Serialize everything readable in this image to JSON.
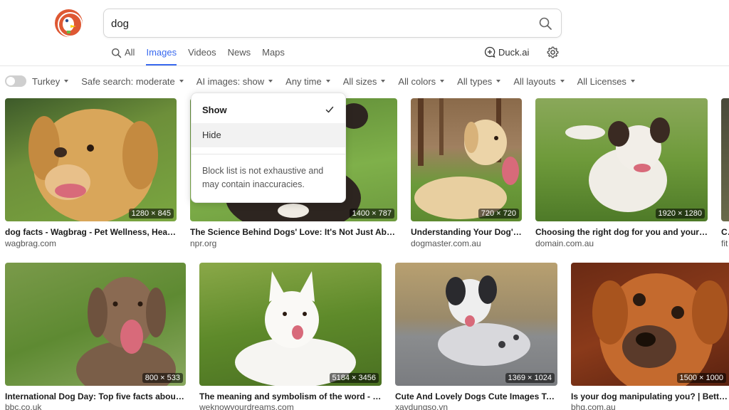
{
  "search": {
    "query": "dog"
  },
  "tabs": [
    {
      "label": "All",
      "icon": "search-icon"
    },
    {
      "label": "Images",
      "active": true
    },
    {
      "label": "Videos"
    },
    {
      "label": "News"
    },
    {
      "label": "Maps"
    }
  ],
  "header": {
    "duck_ai_label": "Duck.ai"
  },
  "filters": {
    "region": "Turkey",
    "safe_search": "Safe search: moderate",
    "ai_images": "AI images: show",
    "time": "Any time",
    "sizes": "All sizes",
    "colors": "All colors",
    "types": "All types",
    "layouts": "All layouts",
    "licenses": "All Licenses"
  },
  "dropdown": {
    "options": [
      {
        "label": "Show",
        "selected": true
      },
      {
        "label": "Hide",
        "selected": false
      }
    ],
    "note": "Block list is not exhaustive and may contain inaccuracies."
  },
  "results_row1": [
    {
      "title": "dog facts - Wagbrag - Pet Wellness, Healthcare",
      "site": "wagbrag.com",
      "dims": "1280 × 845"
    },
    {
      "title": "The Science Behind Dogs' Love: It's Not Just About Food",
      "site": "npr.org",
      "dims": "1400 × 787"
    },
    {
      "title": "Understanding Your Dog's Behaviour",
      "site": "dogmaster.com.au",
      "dims": "720 × 720"
    },
    {
      "title": "Choosing the right dog for you and your family",
      "site": "domain.com.au",
      "dims": "1920 × 1280"
    },
    {
      "title": "Cu",
      "site": "fit",
      "dims": ""
    }
  ],
  "results_row2": [
    {
      "title": "International Dog Day: Top five facts about dogs",
      "site": "bbc.co.uk",
      "dims": "800 × 533"
    },
    {
      "title": "The meaning and symbolism of the word - dog",
      "site": "weknowyourdreams.com",
      "dims": "5184 × 3456"
    },
    {
      "title": "Cute And Lovely Dogs Cute Images Top Dogs",
      "site": "xaydungso.vn",
      "dims": "1369 × 1024"
    },
    {
      "title": "Is your dog manipulating you? | Better Homes",
      "site": "bhg.com.au",
      "dims": "1500 × 1000"
    }
  ],
  "colors": {
    "accent": "#3969ef",
    "logo": "#de5833"
  }
}
